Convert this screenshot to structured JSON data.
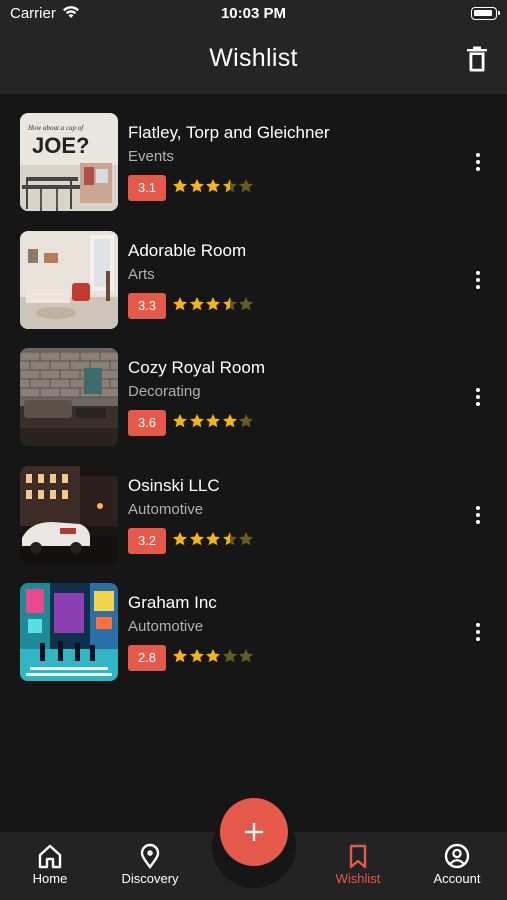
{
  "status_bar": {
    "carrier": "Carrier",
    "time": "10:03 PM"
  },
  "header": {
    "title": "Wishlist"
  },
  "colors": {
    "accent": "#e4594a",
    "background": "#161616",
    "star": "#f3b511"
  },
  "items": [
    {
      "name": "Flatley, Torp and Gleichner",
      "category": "Events",
      "rating": "3.1",
      "stars": 3.5,
      "image": "cafe"
    },
    {
      "name": "Adorable Room",
      "category": "Arts",
      "rating": "3.3",
      "stars": 3.5,
      "image": "livingroom"
    },
    {
      "name": "Cozy Royal Room",
      "category": "Decorating",
      "rating": "3.6",
      "stars": 4,
      "image": "brickroom"
    },
    {
      "name": "Osinski LLC",
      "category": "Automotive",
      "rating": "3.2",
      "stars": 3.5,
      "image": "car"
    },
    {
      "name": "Graham Inc",
      "category": "Automotive",
      "rating": "2.8",
      "stars": 3,
      "image": "neonstreet"
    }
  ],
  "thumb_text": {
    "cafe_small": "How about a cup of",
    "cafe_big": "JOE?"
  },
  "nav": {
    "home": "Home",
    "discovery": "Discovery",
    "wishlist": "Wishlist",
    "account": "Account",
    "fab_icon": "plus-icon"
  }
}
